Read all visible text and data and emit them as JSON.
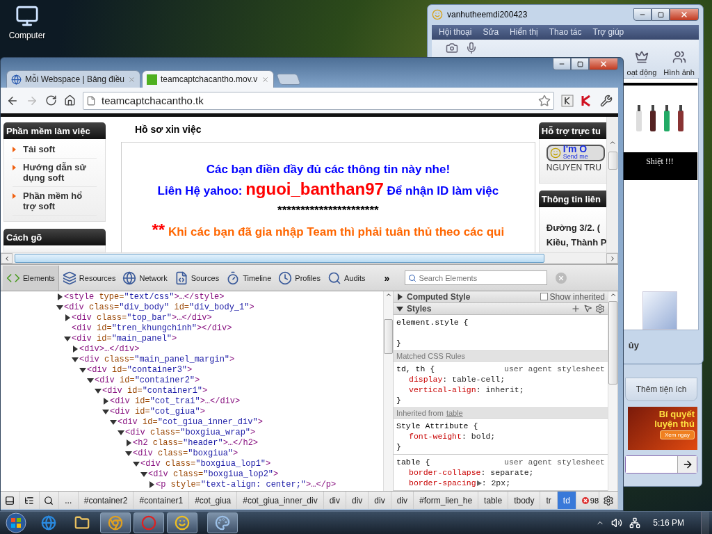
{
  "desktop": {
    "icons": [
      {
        "label": "Computer"
      }
    ]
  },
  "messenger": {
    "title": "vanhutheemdi200423",
    "menu": [
      "Hội thoại",
      "Sửa",
      "Hiển thị",
      "Thao tác",
      "Trợ giúp"
    ],
    "toolbar": [
      {
        "kind": "camera"
      },
      {
        "kind": "mic"
      },
      {
        "kind": "chess",
        "label": "oạt động"
      },
      {
        "kind": "photos",
        "label": "Hình ảnh"
      }
    ],
    "ad_caption": "Shiệt !!!",
    "status_text": "ủy",
    "button": "Thêm tiện ích",
    "banner": {
      "title": "Bí quyết luyện thú",
      "button": "Xem ngay"
    }
  },
  "browser": {
    "tabs": [
      {
        "label": "Mỗi Webspace | Bảng điều",
        "selected": false
      },
      {
        "label": "teamcaptchacantho.mov.v",
        "selected": true
      }
    ],
    "address": "teamcaptchacantho.tk",
    "page": {
      "left_boxes": [
        {
          "title": "Phần mềm làm việc",
          "items": [
            "Tải soft",
            "Hướng dẫn sử dụng soft",
            "Phần mềm hổ trợ soft"
          ]
        },
        {
          "title": "Cách gõ"
        }
      ],
      "heading": "Hồ sơ xin việc",
      "lines": [
        [
          {
            "text": "Các bạn điền đầy đủ các  thông tin này nhe!",
            "color": "#0000ff",
            "kind": "normal"
          }
        ],
        [
          {
            "text": "Liên Hệ yahoo: ",
            "color": "#0000ff",
            "kind": "normal"
          },
          {
            "text": "nguoi_banthan97",
            "color": "#ff0000",
            "kind": "big"
          },
          {
            "text": " Để nhận ID làm việc",
            "color": "#0000ff",
            "kind": "normal"
          }
        ],
        [
          {
            "text": "**********************",
            "color": "#000000",
            "kind": "normal"
          }
        ],
        [
          {
            "text": "**",
            "color": "#ff0000",
            "kind": "big"
          },
          {
            "text": " Khi các bạn đã gia nhập Team thì phải tuân thủ theo các qui",
            "color": "#ff6600",
            "kind": "normal"
          }
        ]
      ],
      "support": {
        "title": "Hỗ trợ trực tu",
        "badge_title": "I'm O",
        "badge_subtitle": "Send me",
        "name": "NGUYEN TRU"
      },
      "contact": {
        "title": "Thông tin liên",
        "lines": [
          "Đường 3/2. (",
          "Kiều, Thành P"
        ]
      }
    }
  },
  "devtools": {
    "panels": [
      {
        "label": "Elements",
        "kind": "elements",
        "selected": true
      },
      {
        "label": "Resources",
        "kind": "resources",
        "selected": false
      },
      {
        "label": "Network",
        "kind": "network",
        "selected": false
      },
      {
        "label": "Sources",
        "kind": "sources",
        "selected": false
      },
      {
        "label": "Timeline",
        "kind": "timeline",
        "selected": false
      },
      {
        "label": "Profiles",
        "kind": "profiles",
        "selected": false
      },
      {
        "label": "Audits",
        "kind": "audits",
        "selected": false
      }
    ],
    "overflow": "»",
    "search_placeholder": "Search Elements",
    "dom_tree": [
      {
        "text": "<style type=\"text/css\">…</style>",
        "kind": "branch",
        "expanded": false
      },
      {
        "text": "<div class=\"div_body\" id=\"div_body_1\">",
        "kind": "branch",
        "expanded": true,
        "children": [
          {
            "text": "<div class=\"top_bar\">…</div>",
            "kind": "branch",
            "expanded": false
          },
          {
            "text": "<div id=\"tren_khungchinh\"></div>",
            "kind": "leaf"
          },
          {
            "text": "<div id=\"main_panel\">",
            "kind": "branch",
            "expanded": true,
            "children": [
              {
                "text": "<div>…</div>",
                "kind": "branch",
                "expanded": false
              },
              {
                "text": "<div class=\"main_panel_margin\">",
                "kind": "branch",
                "expanded": true,
                "children": [
                  {
                    "text": "<div id=\"container3\">",
                    "kind": "branch",
                    "expanded": true,
                    "children": [
                      {
                        "text": "<div id=\"container2\">",
                        "kind": "branch",
                        "expanded": true,
                        "children": [
                          {
                            "text": "<div id=\"container1\">",
                            "kind": "branch",
                            "expanded": true,
                            "children": [
                              {
                                "text": "<div id=\"cot_trai\">…</div>",
                                "kind": "branch",
                                "expanded": false
                              },
                              {
                                "text": "<div id=\"cot_giua\">",
                                "kind": "branch",
                                "expanded": true,
                                "children": [
                                  {
                                    "text": "<div id=\"cot_giua_inner_div\">",
                                    "kind": "branch",
                                    "expanded": true,
                                    "children": [
                                      {
                                        "text": "<div class=\"boxgiua_wrap\">",
                                        "kind": "branch",
                                        "expanded": true,
                                        "children": [
                                          {
                                            "text": "<h2 class=\"header\">…</h2>",
                                            "kind": "branch",
                                            "expanded": false
                                          },
                                          {
                                            "text": "<div class=\"boxgiua\">",
                                            "kind": "branch",
                                            "expanded": true,
                                            "children": [
                                              {
                                                "text": "<div class=\"boxgiua_lop1\">",
                                                "kind": "branch",
                                                "expanded": true,
                                                "children": [
                                                  {
                                                    "text": "<div class=\"boxgiua_lop2\">",
                                                    "kind": "branch",
                                                    "expanded": true,
                                                    "children": [
                                                      {
                                                        "text": "<p style=\"text-align: center;\">…</p>",
                                                        "kind": "branch",
                                                        "expanded": false
                                                      }
                                                    ]
                                                  }
                                                ]
                                              }
                                            ]
                                          }
                                        ]
                                      }
                                    ]
                                  }
                                ]
                              }
                            ]
                          }
                        ]
                      }
                    ]
                  }
                ]
              }
            ]
          }
        ]
      }
    ],
    "computed": {
      "title": "Computed Style",
      "expanded": false
    },
    "show_inherited": {
      "label": "Show inherited",
      "checked": false
    },
    "styles": {
      "title": "Styles",
      "expanded": true
    },
    "rules": [
      {
        "kind": "rule",
        "selector": "element.style {",
        "close": "}"
      },
      {
        "kind": "header",
        "text": "Matched CSS Rules"
      },
      {
        "kind": "rule",
        "selector": "td, th {",
        "source": "user agent stylesheet",
        "close": "}",
        "properties": [
          {
            "name": "display",
            "value": ": table-cell;"
          },
          {
            "name": "vertical-align",
            "value": ": inherit;"
          }
        ]
      },
      {
        "kind": "header",
        "text": "Inherited from",
        "link": "table"
      },
      {
        "kind": "rule",
        "selector": "Style Attribute {",
        "close": "}",
        "properties": [
          {
            "name": "font-weight",
            "value": ": bold;"
          }
        ]
      },
      {
        "kind": "rule",
        "selector": "table {",
        "source": "user agent stylesheet",
        "properties": [
          {
            "name": "border-collapse",
            "value": ": separate;"
          },
          {
            "name": "border-spacing",
            "value": ": 2px;",
            "expandable": true
          }
        ]
      }
    ],
    "more": "...",
    "breadcrumbs": [
      {
        "label": "#container2",
        "selected": false
      },
      {
        "label": "#container1",
        "selected": false
      },
      {
        "label": "#cot_giua",
        "selected": false
      },
      {
        "label": "#cot_giua_inner_div",
        "selected": false
      },
      {
        "label": "div",
        "selected": false
      },
      {
        "label": "div",
        "selected": false
      },
      {
        "label": "div",
        "selected": false
      },
      {
        "label": "div",
        "selected": false
      },
      {
        "label": "#form_lien_he",
        "selected": false
      },
      {
        "label": "table",
        "selected": false
      },
      {
        "label": "tbody",
        "selected": false
      },
      {
        "label": "tr",
        "selected": false
      },
      {
        "label": "td",
        "selected": true
      }
    ],
    "error_count": "98"
  },
  "taskbar": {
    "apps": [
      {
        "kind": "ie",
        "active": false
      },
      {
        "kind": "folder",
        "active": false
      },
      {
        "kind": "chrome",
        "active": true
      },
      {
        "kind": "opera",
        "active": true
      },
      {
        "kind": "smiley",
        "active": true
      },
      {
        "kind": "paint",
        "active": true
      }
    ],
    "clock": "5:16 PM"
  }
}
